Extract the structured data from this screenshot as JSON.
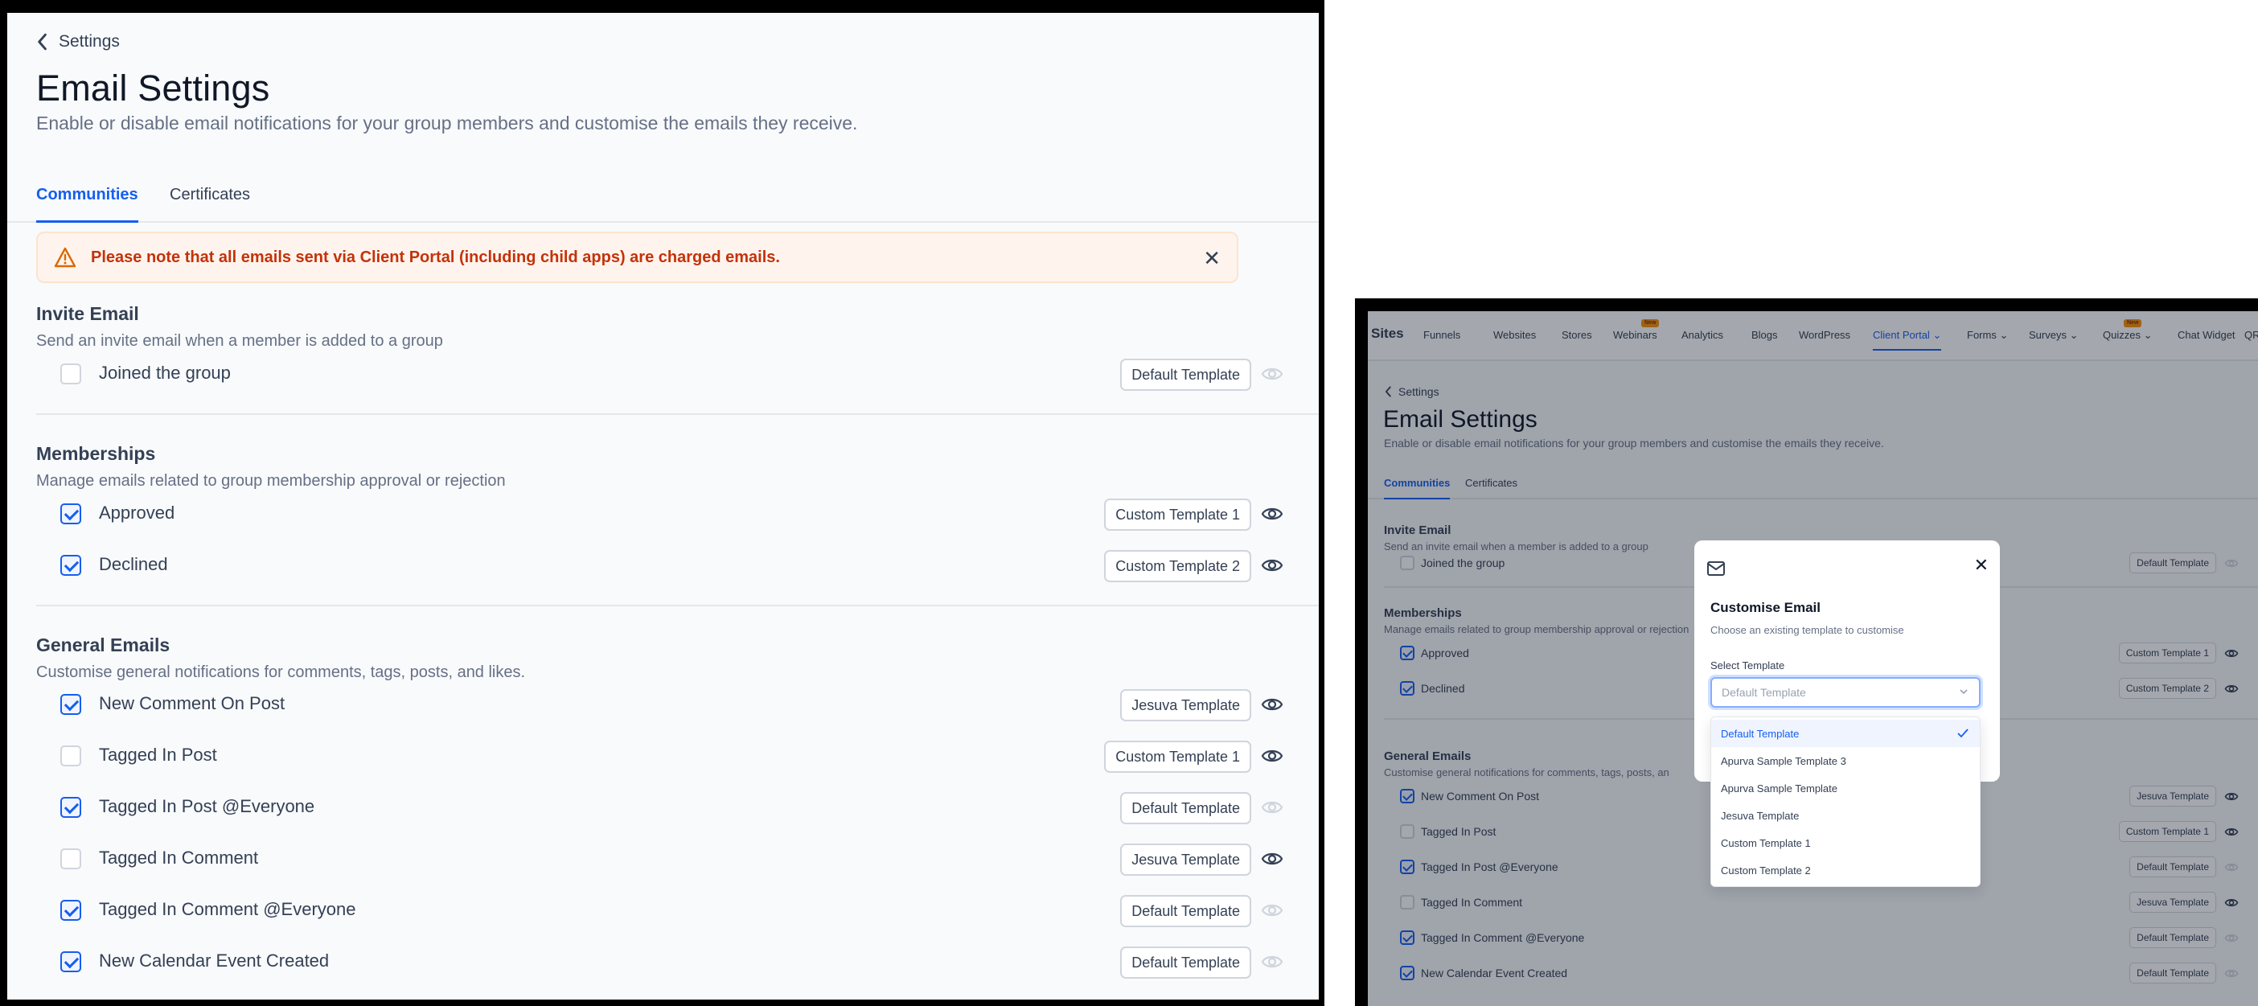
{
  "colors": {
    "primary": "#155eef",
    "warning_bg": "#fff4ed",
    "warning_text": "#c4320a",
    "new_badge": "#f79009"
  },
  "breadcrumb": {
    "back_label": "Settings"
  },
  "page": {
    "title": "Email Settings",
    "subtitle": "Enable or disable email notifications for your group members and customise the emails they receive."
  },
  "tabs": [
    {
      "label": "Communities",
      "active": true
    },
    {
      "label": "Certificates",
      "active": false
    }
  ],
  "alert": {
    "message": "Please note that all emails sent via Client Portal (including child apps) are charged emails."
  },
  "sections": {
    "invite": {
      "title": "Invite Email",
      "description": "Send an invite email when a member is added to a group",
      "items": [
        {
          "label": "Joined the group",
          "checked": false,
          "template": "Default Template"
        }
      ]
    },
    "memberships": {
      "title": "Memberships",
      "description": "Manage emails related to group membership approval or rejection",
      "items": [
        {
          "label": "Approved",
          "checked": true,
          "template": "Custom Template 1"
        },
        {
          "label": "Declined",
          "checked": true,
          "template": "Custom Template 2"
        }
      ]
    },
    "general": {
      "title": "General Emails",
      "description": "Customise general notifications for comments, tags, posts, and likes.",
      "description_truncated": "Customise general notifications for comments, tags, posts, an",
      "items": [
        {
          "label": "New Comment On Post",
          "checked": true,
          "template": "Jesuva Template"
        },
        {
          "label": "Tagged In Post",
          "checked": false,
          "template": "Custom Template 1"
        },
        {
          "label": "Tagged In Post @Everyone",
          "checked": true,
          "template": "Default Template"
        },
        {
          "label": "Tagged In Comment",
          "checked": false,
          "template": "Jesuva Template"
        },
        {
          "label": "Tagged In Comment @Everyone",
          "checked": true,
          "template": "Default Template"
        },
        {
          "label": "New Calendar Event Created",
          "checked": true,
          "template": "Default Template"
        }
      ]
    }
  },
  "topnav": {
    "brand": "Sites",
    "items": [
      "Funnels",
      "Websites",
      "Stores",
      "Webinars",
      "Analytics",
      "Blogs",
      "WordPress",
      "Client Portal",
      "Forms",
      "Surveys",
      "Quizzes",
      "Chat Widget",
      "QR Codes"
    ],
    "badge_new": "New"
  },
  "modal": {
    "title": "Customise Email",
    "description": "Choose an existing template to customise",
    "select_label": "Select Template",
    "select_placeholder": "Default Template",
    "options": [
      {
        "label": "Default Template",
        "selected": true
      },
      {
        "label": "Apurva Sample Template 3",
        "selected": false
      },
      {
        "label": "Apurva Sample Template",
        "selected": false
      },
      {
        "label": "Jesuva Template",
        "selected": false
      },
      {
        "label": "Custom Template 1",
        "selected": false
      },
      {
        "label": "Custom Template 2",
        "selected": false
      }
    ]
  }
}
